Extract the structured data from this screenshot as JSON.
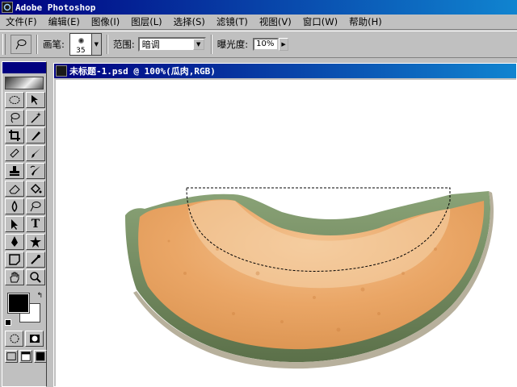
{
  "app": {
    "title": "Adobe Photoshop"
  },
  "menu": {
    "items": [
      "文件(F)",
      "编辑(E)",
      "图像(I)",
      "图层(L)",
      "选择(S)",
      "滤镜(T)",
      "视图(V)",
      "窗口(W)",
      "帮助(H)"
    ]
  },
  "options": {
    "tool_icon": "dodge-icon",
    "brush_label": "画笔:",
    "brush_size": "35",
    "range_label": "范围:",
    "range_value": "暗调",
    "exposure_label": "曝光度:",
    "exposure_value": "10%"
  },
  "document": {
    "title": "未标题-1.psd @ 100%(瓜肉,RGB)"
  },
  "toolbox": {
    "tools": [
      "marquee-icon",
      "move-icon",
      "lasso-icon",
      "magic-wand-icon",
      "crop-icon",
      "slice-icon",
      "healing-brush-icon",
      "brush-icon",
      "clone-stamp-icon",
      "history-brush-icon",
      "eraser-icon",
      "paint-bucket-icon",
      "blur-icon",
      "dodge-icon",
      "path-select-icon",
      "type-icon",
      "pen-icon",
      "custom-shape-icon",
      "notes-icon",
      "eyedropper-icon",
      "hand-icon",
      "zoom-icon"
    ],
    "foreground_color": "#000000",
    "background_color": "#ffffff",
    "type_glyph": "T"
  },
  "colors": {
    "titlebar_start": "#000080",
    "titlebar_end": "#1084d0",
    "chrome": "#c0c0c0",
    "melon_flesh": "#e9a463",
    "melon_rind": "#6f8a5e"
  }
}
